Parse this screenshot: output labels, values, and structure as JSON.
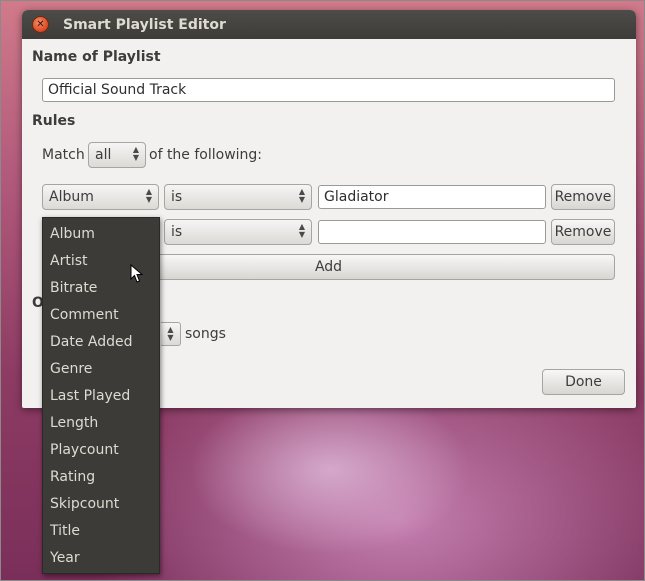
{
  "window": {
    "title": "Smart Playlist Editor",
    "close_glyph": "✕"
  },
  "name_section": {
    "heading": "Name of Playlist",
    "value": "Official Sound Track"
  },
  "rules_section": {
    "heading": "Rules",
    "match_prefix": "Match",
    "match_value": "all",
    "match_suffix": "of the following:",
    "rule1": {
      "field": "Album",
      "operator": "is",
      "value": "Gladiator",
      "remove_label": "Remove"
    },
    "rule2": {
      "operator": "is",
      "value": "",
      "remove_label": "Remove"
    },
    "add_label": "Add"
  },
  "limit": {
    "heading_partial": "O",
    "songs_label": "songs"
  },
  "done_label": "Done",
  "field_menu": {
    "items": [
      "Album",
      "Artist",
      "Bitrate",
      "Comment",
      "Date Added",
      "Genre",
      "Last Played",
      "Length",
      "Playcount",
      "Rating",
      "Skipcount",
      "Title",
      "Year"
    ]
  },
  "icons": {
    "spin_arrows": "▲▼",
    "cursor": "mouse-pointer-icon"
  }
}
